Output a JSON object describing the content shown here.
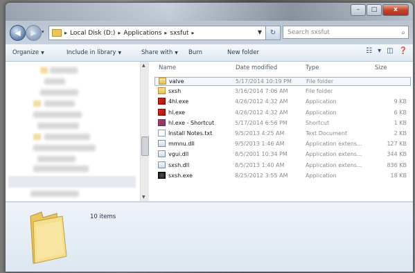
{
  "window": {
    "caption_buttons": [
      "–",
      "□",
      "x"
    ]
  },
  "nav": {
    "back_glyph": "◀",
    "forward_glyph": "▶",
    "history_glyph": "▾",
    "breadcrumb": [
      "Local Disk (D:)",
      "Applications",
      "sxsfut"
    ],
    "separator": "▸",
    "refresh_glyph": "↻",
    "search_placeholder": "Search sxsfut",
    "search_icon": "⌕"
  },
  "commands": {
    "organize": "Organize",
    "include_in_library": "Include in library",
    "share_with": "Share with",
    "burn": "Burn",
    "new_folder": "New folder",
    "dropdown_glyph": "▼",
    "view_icons": [
      "☷",
      "▾",
      "◫",
      "❓"
    ]
  },
  "columns": {
    "name": "Name",
    "date_modified": "Date modified",
    "type": "Type",
    "size": "Size",
    "sort_glyph": "^"
  },
  "files": [
    {
      "name": "valve",
      "date": "5/17/2014 10:19 PM",
      "type": "File folder",
      "size": "",
      "icon": "folder"
    },
    {
      "name": "sxsh",
      "date": "3/16/2014 7:06 AM",
      "type": "File folder",
      "size": "",
      "icon": "folder"
    },
    {
      "name": "4hl.exe",
      "date": "4/26/2012 4:32 AM",
      "type": "Application",
      "size": "9 KB",
      "icon": "app"
    },
    {
      "name": "hl.exe",
      "date": "4/26/2012 4:32 AM",
      "type": "Application",
      "size": "6 KB",
      "icon": "app"
    },
    {
      "name": "hl.exe - Shortcut",
      "date": "5/17/2014 6:56 PM",
      "type": "Shortcut",
      "size": "1 KB",
      "icon": "shortcut"
    },
    {
      "name": "Install Notes.txt",
      "date": "9/5/2013 4:25 AM",
      "type": "Text Document",
      "size": "2 KB",
      "icon": "doc"
    },
    {
      "name": "mmnu.dll",
      "date": "9/5/2013 1:46 AM",
      "type": "Application extens...",
      "size": "127 KB",
      "icon": "dll"
    },
    {
      "name": "vgui.dll",
      "date": "8/5/2001 10:34 PM",
      "type": "Application extens...",
      "size": "344 KB",
      "icon": "dll"
    },
    {
      "name": "sxsh.dll",
      "date": "8/5/2013 1:40 AM",
      "type": "Application extens...",
      "size": "836 KB",
      "icon": "dll"
    },
    {
      "name": "sxsh.exe",
      "date": "8/25/2012 3:55 AM",
      "type": "Application",
      "size": "18 KB",
      "icon": "steam"
    }
  ],
  "details": {
    "item_count": "10 items"
  }
}
